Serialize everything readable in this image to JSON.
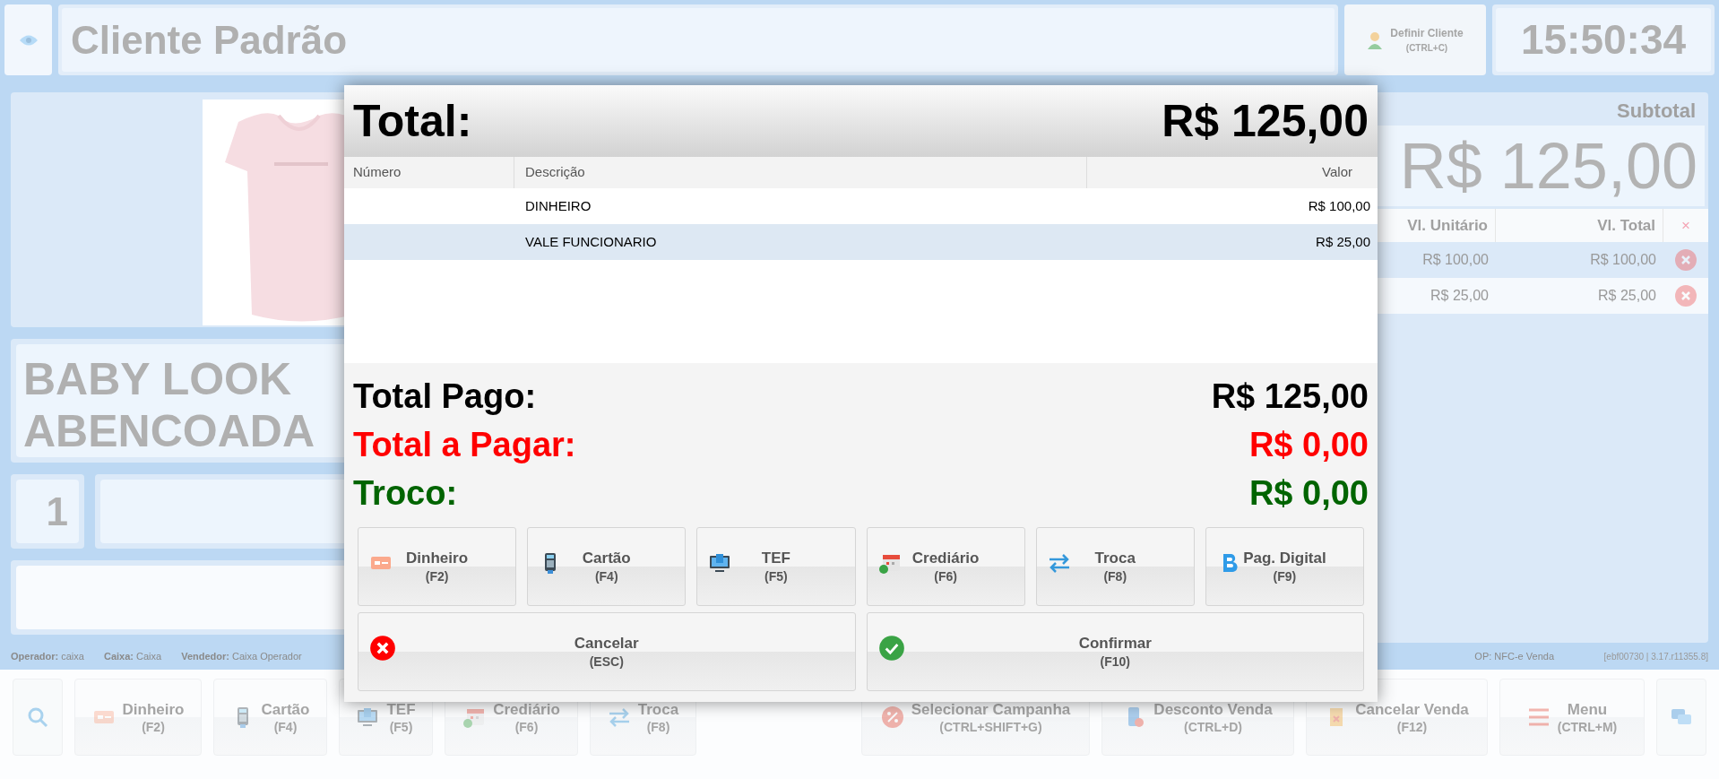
{
  "top_bar": {
    "client_name": "Cliente Padrão",
    "define_client": {
      "label": "Definir Cliente",
      "shortcut": "(CTRL+C)"
    },
    "clock": "15:50:34"
  },
  "product": {
    "name": "BABY LOOK ABENCOADA",
    "quantity": "1"
  },
  "subtotal": {
    "label": "Subtotal",
    "amount": "R$ 125,00"
  },
  "items_table": {
    "columns": [
      "Vl. Unitário",
      "Vl. Total",
      "×"
    ],
    "rows": [
      {
        "unit": "R$ 100,00",
        "total": "R$ 100,00"
      },
      {
        "unit": "R$ 25,00",
        "total": "R$ 25,00"
      }
    ]
  },
  "status_bar": {
    "fields": [
      "**Operador:** caixa",
      "**Caixa:** Caixa",
      "**Vendedor:** Caixa Operador"
    ],
    "op": "OP: NFC-e Venda",
    "version": "[ebf00730 | 3.17.r11355.8]"
  },
  "toolbar": [
    {
      "kind": "search"
    },
    {
      "kind": "cash",
      "label": "Dinheiro",
      "shortcut": "(F2)"
    },
    {
      "kind": "card",
      "label": "Cartão",
      "shortcut": "(F4)"
    },
    {
      "kind": "tef",
      "label": "TEF",
      "shortcut": "(F5)"
    },
    {
      "kind": "credit",
      "label": "Crediário",
      "shortcut": "(F6)"
    },
    {
      "kind": "exchange",
      "label": "Troca",
      "shortcut": "(F8)"
    },
    {
      "kind": "campaign",
      "label": "Selecionar Campanha",
      "shortcut": "(CTRL+SHIFT+G)"
    },
    {
      "kind": "discount",
      "label": "Desconto Venda",
      "shortcut": "(CTRL+D)"
    },
    {
      "kind": "cancel_sale",
      "label": "Cancelar Venda",
      "shortcut": "(F12)"
    },
    {
      "kind": "menu",
      "label": "Menu",
      "shortcut": "(CTRL+M)"
    },
    {
      "kind": "chat"
    }
  ],
  "payment_dialog": {
    "title": "Total:",
    "total": "R$ 125,00",
    "columns": [
      "Número",
      "Descrição",
      "Valor"
    ],
    "payments": [
      {
        "description": "DINHEIRO",
        "value": "R$ 100,00",
        "selected": false
      },
      {
        "description": "VALE FUNCIONARIO",
        "value": "R$ 25,00",
        "selected": true
      }
    ],
    "summary": [
      {
        "kind": "paid",
        "label": "Total Pago:",
        "value": "R$ 125,00"
      },
      {
        "kind": "due",
        "label": "Total a Pagar:",
        "value": "R$ 0,00"
      },
      {
        "kind": "change",
        "label": "Troco:",
        "value": "R$ 0,00"
      }
    ],
    "methods": [
      {
        "kind": "cash",
        "label": "Dinheiro",
        "shortcut": "(F2)"
      },
      {
        "kind": "card",
        "label": "Cartão",
        "shortcut": "(F4)"
      },
      {
        "kind": "tef",
        "label": "TEF",
        "shortcut": "(F5)"
      },
      {
        "kind": "credit",
        "label": "Crediário",
        "shortcut": "(F6)"
      },
      {
        "kind": "exchange",
        "label": "Troca",
        "shortcut": "(F8)"
      },
      {
        "kind": "digital",
        "label": "Pag. Digital",
        "shortcut": "(F9)"
      }
    ],
    "actions": [
      {
        "kind": "cancel",
        "label": "Cancelar",
        "shortcut": "(ESC)"
      },
      {
        "kind": "confirm",
        "label": "Confirmar",
        "shortcut": "(F10)"
      }
    ]
  }
}
